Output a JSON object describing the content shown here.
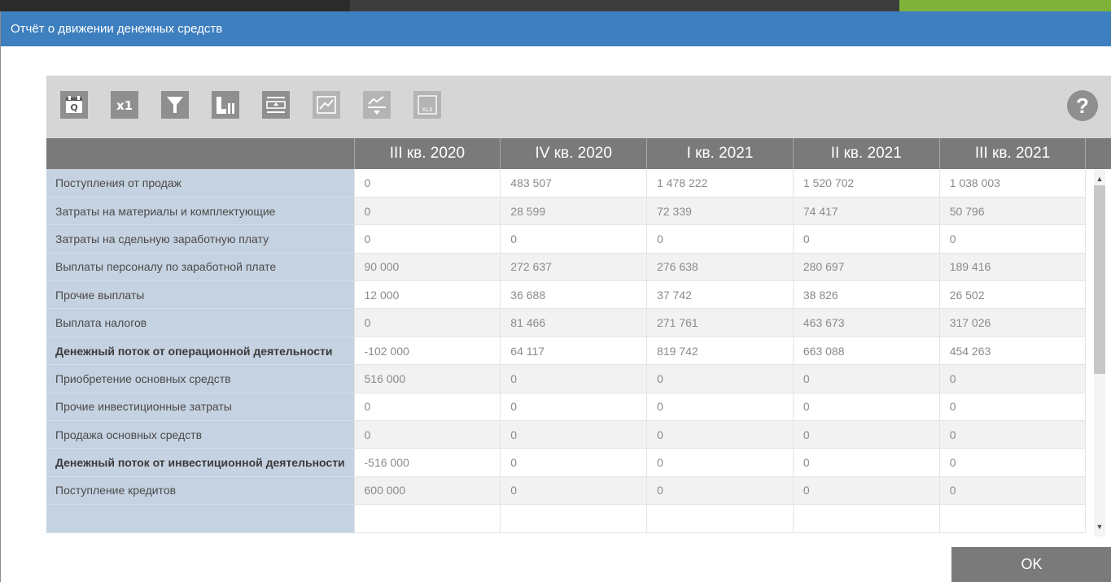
{
  "dialog": {
    "title": "Отчёт о движении денежных средств",
    "ok_label": "OK"
  },
  "toolbar": {
    "buttons": [
      {
        "icon": "calendar-q-icon",
        "label": "Q",
        "enabled": true
      },
      {
        "icon": "multiplier-icon",
        "label": "x1",
        "enabled": true
      },
      {
        "icon": "filter-icon",
        "enabled": true
      },
      {
        "icon": "bar-chart-icon",
        "enabled": true
      },
      {
        "icon": "insert-row-icon",
        "enabled": true
      },
      {
        "icon": "trend-chart-icon",
        "enabled": false
      },
      {
        "icon": "trend-down-icon",
        "enabled": false
      },
      {
        "icon": "xls-export-icon",
        "label": "XLS",
        "enabled": false
      }
    ],
    "help_label": "?"
  },
  "table": {
    "columns": [
      "",
      "III кв. 2020",
      "IV кв. 2020",
      "I кв. 2021",
      "II кв. 2021",
      "III кв. 2021"
    ],
    "rows": [
      {
        "name": "Поступления от продаж",
        "bold": false,
        "values": [
          "0",
          "483 507",
          "1 478 222",
          "1 520 702",
          "1 038 003"
        ]
      },
      {
        "name": "Затраты на материалы и комплектующие",
        "bold": false,
        "values": [
          "0",
          "28 599",
          "72 339",
          "74 417",
          "50 796"
        ]
      },
      {
        "name": "Затраты на сдельную заработную плату",
        "bold": false,
        "values": [
          "0",
          "0",
          "0",
          "0",
          "0"
        ]
      },
      {
        "name": "Выплаты персоналу по заработной плате",
        "bold": false,
        "values": [
          "90 000",
          "272 637",
          "276 638",
          "280 697",
          "189 416"
        ]
      },
      {
        "name": "Прочие выплаты",
        "bold": false,
        "values": [
          "12 000",
          "36 688",
          "37 742",
          "38 826",
          "26 502"
        ]
      },
      {
        "name": "Выплата налогов",
        "bold": false,
        "values": [
          "0",
          "81 466",
          "271 761",
          "463 673",
          "317 026"
        ]
      },
      {
        "name": "Денежный поток от операционной деятельности",
        "bold": true,
        "values": [
          "-102 000",
          "64 117",
          "819 742",
          "663 088",
          "454 263"
        ]
      },
      {
        "name": "Приобретение основных средств",
        "bold": false,
        "values": [
          "516 000",
          "0",
          "0",
          "0",
          "0"
        ]
      },
      {
        "name": "Прочие инвестиционные затраты",
        "bold": false,
        "values": [
          "0",
          "0",
          "0",
          "0",
          "0"
        ]
      },
      {
        "name": "Продажа основных средств",
        "bold": false,
        "values": [
          "0",
          "0",
          "0",
          "0",
          "0"
        ]
      },
      {
        "name": "Денежный поток от инвестиционной деятельности",
        "bold": true,
        "values": [
          "-516 000",
          "0",
          "0",
          "0",
          "0"
        ]
      },
      {
        "name": "Поступление кредитов",
        "bold": false,
        "values": [
          "600 000",
          "0",
          "0",
          "0",
          "0"
        ]
      },
      {
        "name": "",
        "bold": false,
        "values": [
          "",
          "",
          "",
          "",
          ""
        ]
      }
    ]
  },
  "colors": {
    "title_bar": "#3d7fbf",
    "header": "#7a7a7a",
    "name_column": "#c5d2e1",
    "toolbar": "#d6d6d6"
  }
}
